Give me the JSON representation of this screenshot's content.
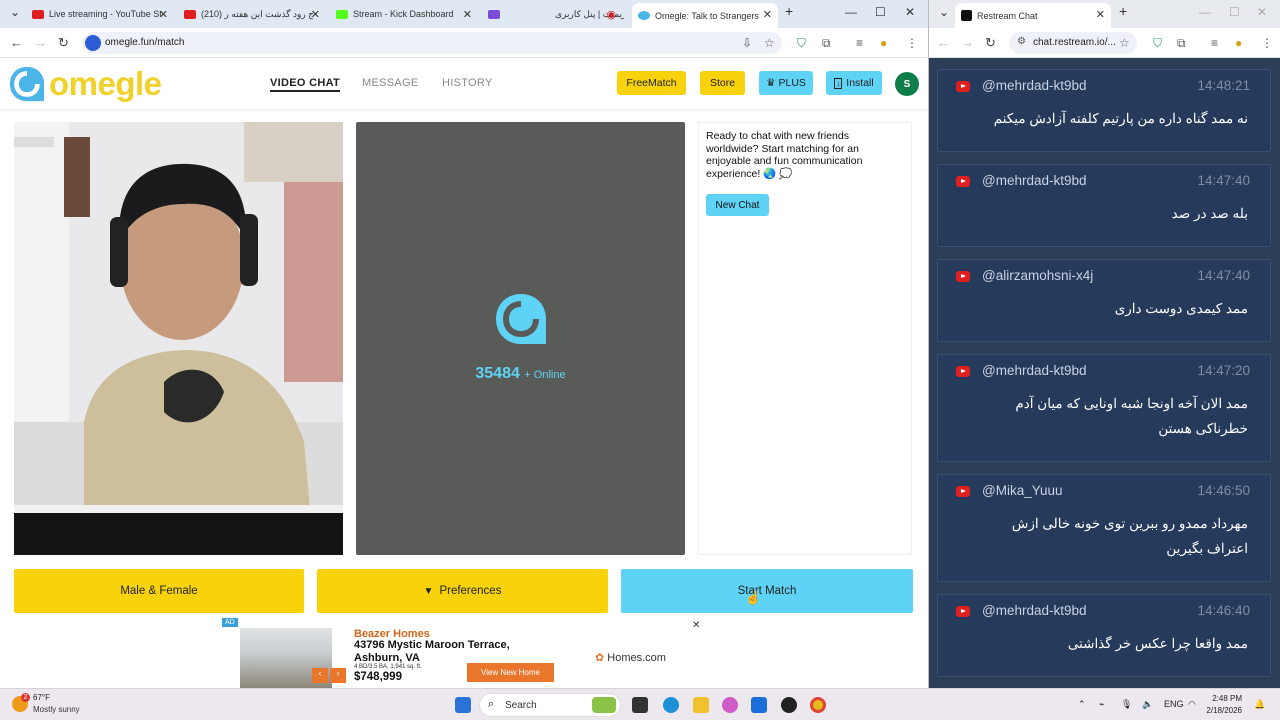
{
  "left_browser": {
    "tabs": [
      {
        "title": "Live streaming - YouTube Stu",
        "icon_color": "#e02020"
      },
      {
        "title": "ج رود گذشت این هفته ر (210)",
        "icon_color": "#e02020"
      },
      {
        "title": "Stream - Kick Dashboard",
        "icon_color": "#53fc18"
      },
      {
        "title": "ریمیت | پنل کاربری",
        "icon_color": "#7b4ad6"
      },
      {
        "title": "Omegle: Talk to Strangers",
        "icon_color": "#4bb4e8",
        "active": true
      }
    ],
    "url": "omegle.fun/match"
  },
  "site": {
    "logo_text": "omegle",
    "nav": {
      "video_chat": "VIDEO CHAT",
      "message": "MESSAGE",
      "history": "HISTORY"
    },
    "header_buttons": {
      "freematch": "FreeMatch",
      "store": "Store",
      "plus": "PLUS",
      "install": "Install"
    },
    "avatar_initial": "S",
    "online": {
      "count": "35484",
      "label": "+ Online"
    },
    "welcome_text": "Ready to chat with new friends worldwide? Start matching for an enjoyable and fun communication experience! 🌏 💭",
    "new_chat_label": "New Chat",
    "bottom_buttons": {
      "gender": "Male & Female",
      "preferences": "Preferences",
      "start": "Start Match"
    },
    "colors": {
      "yellow": "#f8d30b",
      "cyan": "#5fd3f5",
      "panel_gray": "#585b58"
    }
  },
  "ad": {
    "badge": "AD",
    "brand": "Beazer Homes",
    "address": "43796 Mystic Maroon Terrace, Ashburn, VA",
    "specs": "4 BD/3.5 BA, 1,941 sq. ft.",
    "price": "$748,999",
    "cta": "View New Home",
    "logo": "Homes.com"
  },
  "right_browser": {
    "tab_title": "Restream Chat",
    "url": "chat.restream.io/...",
    "messages": [
      {
        "user": "@mehrdad-kt9bd",
        "time": "14:48:21",
        "text": "نه ممد گناه داره من پارتیم کلفته آزادش میکنم"
      },
      {
        "user": "@mehrdad-kt9bd",
        "time": "14:47:40",
        "text": "بله صد در صد"
      },
      {
        "user": "@alirzamohsni-x4j",
        "time": "14:47:40",
        "text": "ممد کیمدی دوست داری"
      },
      {
        "user": "@mehrdad-kt9bd",
        "time": "14:47:20",
        "text": "ممد الان آخه اونجا شبه اونایی که میان آدم خطرناکی هستن"
      },
      {
        "user": "@Mika_Yuuu",
        "time": "14:46:50",
        "text": "مهرداد ممدو رو ببرین توی خونه خالی ازش اعتراف بگیرین"
      },
      {
        "user": "@mehrdad-kt9bd",
        "time": "14:46:40",
        "text": "ممد واقعا چرا عکس خر گذاشتی"
      }
    ]
  },
  "taskbar": {
    "weather_badge": "2",
    "temperature": "67°F",
    "condition": "Mostly sunny",
    "search_placeholder": "Search",
    "language": "ENG",
    "time": "2:48 PM",
    "date": "2/18/2026"
  }
}
